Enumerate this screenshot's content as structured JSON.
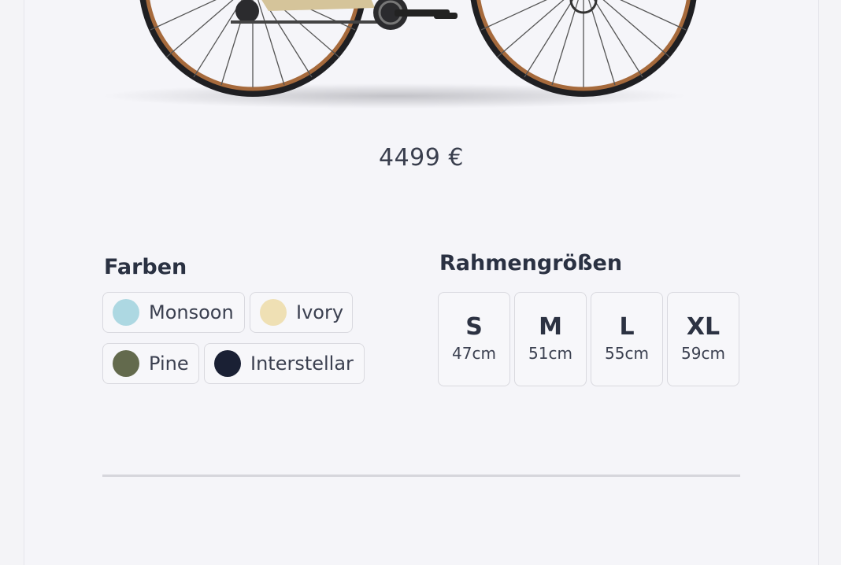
{
  "product": {
    "image_name": "bike-image",
    "price": "4499 €"
  },
  "colors": {
    "title": "Farben",
    "options": [
      {
        "label": "Monsoon",
        "color": "#add8e2"
      },
      {
        "label": "Ivory",
        "color": "#efe0b4"
      },
      {
        "label": "Pine",
        "color": "#636a4d"
      },
      {
        "label": "Interstellar",
        "color": "#1a2034"
      }
    ]
  },
  "sizes": {
    "title": "Rahmengrößen",
    "options": [
      {
        "code": "S",
        "cm": "47cm"
      },
      {
        "code": "M",
        "cm": "51cm"
      },
      {
        "code": "L",
        "cm": "55cm"
      },
      {
        "code": "XL",
        "cm": "59cm"
      }
    ]
  },
  "theme": {
    "frame_color": "#d5c49a",
    "tire_color": "#a66a3c"
  }
}
